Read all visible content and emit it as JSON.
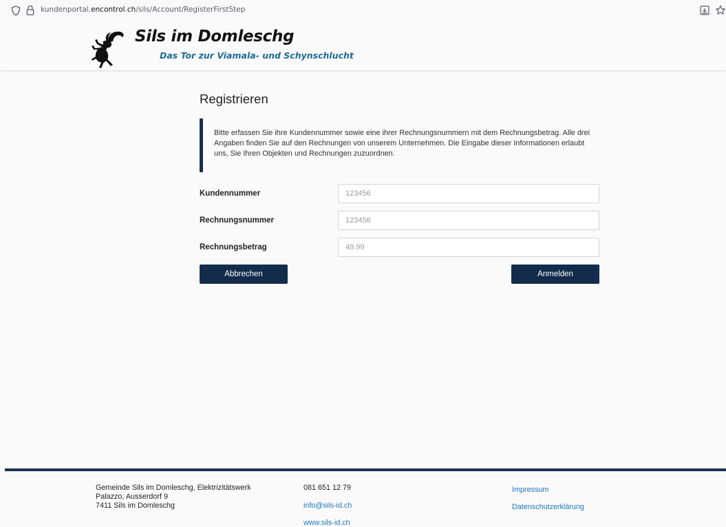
{
  "browser": {
    "url_prefix": "kundenportal.",
    "url_domain": "encontrol.ch",
    "url_path": "/sils/Account/RegisterFirstStep"
  },
  "header": {
    "title": "Sils im Domleschg",
    "subtitle": "Das Tor zur Viamala- und Schynschlucht"
  },
  "main": {
    "title": "Registrieren",
    "info_text": "Bitte erfassen Sie ihre Kundennummer sowie eine ihrer Rechnungsnummern mit dem Rechnungsbetrag. Alle drei Angaben finden Sie auf den Rechnungen von unserem Unternehmen. Die Eingabe dieser Informationen erlaubt uns, Sie Ihren Objekten und Rechnungen zuzuordnen.",
    "fields": [
      {
        "label": "Kundennummer",
        "placeholder": "123456"
      },
      {
        "label": "Rechnungsnummer",
        "placeholder": "123456"
      },
      {
        "label": "Rechnungsbetrag",
        "placeholder": "49.99"
      }
    ],
    "cancel_label": "Abbrechen",
    "submit_label": "Anmelden"
  },
  "footer": {
    "address_line1": "Gemeinde Sils im Domleschg, Elektrizitätswerk",
    "address_line2": "Palazzo, Ausserdorf 9",
    "address_line3": "7411 Sils im Domleschg",
    "phone": "081 651 12 79",
    "email": "info@sils-id.ch",
    "website": "www.sils-id.ch",
    "impressum": "Impressum",
    "privacy": "Datenschutzerklärung"
  },
  "colors": {
    "primary": "#132c4b",
    "link": "#1c78c0",
    "subtitle": "#1e6a95"
  }
}
